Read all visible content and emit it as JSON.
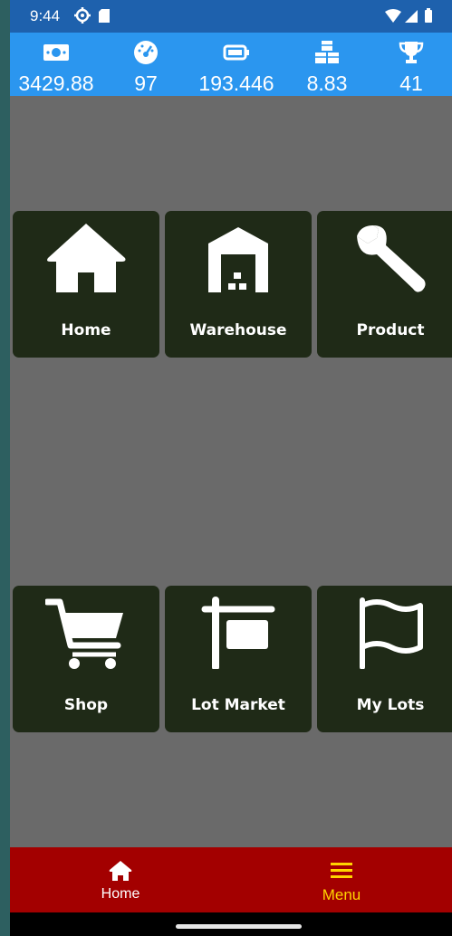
{
  "status_bar": {
    "time": "9:44",
    "icons": [
      "gear-icon",
      "sd-card-icon",
      "wifi-icon",
      "signal-icon",
      "battery-icon"
    ]
  },
  "stats": [
    {
      "icon": "money-icon",
      "value": "3429.88"
    },
    {
      "icon": "speedometer-icon",
      "value": "97"
    },
    {
      "icon": "battery-icon",
      "value": "193.446"
    },
    {
      "icon": "cubes-icon",
      "value": "8.83"
    },
    {
      "icon": "trophy-icon",
      "value": "41"
    }
  ],
  "tiles": [
    {
      "label": "Home",
      "icon": "home-icon"
    },
    {
      "label": "Warehouse",
      "icon": "warehouse-icon"
    },
    {
      "label": "Product",
      "icon": "wrench-icon"
    },
    {
      "label": "Shop",
      "icon": "cart-icon"
    },
    {
      "label": "Lot Market",
      "icon": "signpost-icon"
    },
    {
      "label": "My Lots",
      "icon": "flag-icon"
    }
  ],
  "bottom_nav": {
    "home_label": "Home",
    "menu_label": "Menu"
  },
  "colors": {
    "status_bar": "#1e61ad",
    "stats_bar": "#2b96ef",
    "content_bg": "#6a6a6a",
    "tile_bg": "#1f2a17",
    "bottom_nav_bg": "#a30000",
    "active_nav": "#ffd400"
  }
}
